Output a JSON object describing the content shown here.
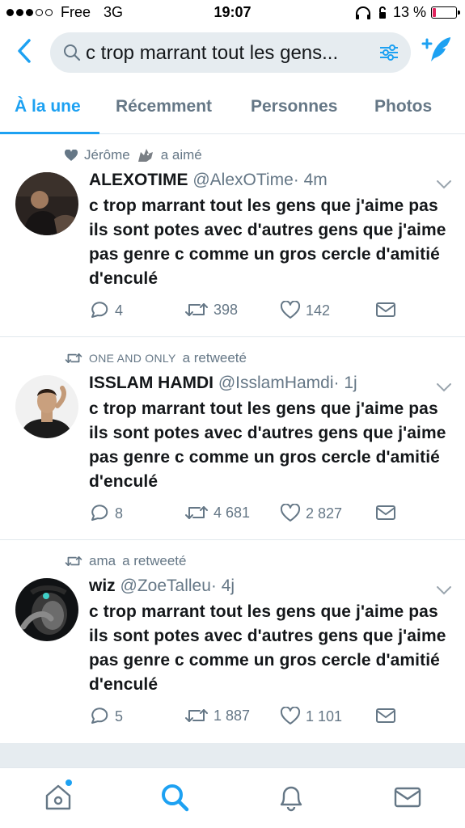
{
  "status_bar": {
    "carrier": "Free",
    "network": "3G",
    "time": "19:07",
    "battery_percent": "13 %",
    "battery_level": 0.13
  },
  "search": {
    "query": "c trop marrant tout les gens..."
  },
  "tabs": [
    {
      "label": "À la une",
      "active": true
    },
    {
      "label": "Récemment",
      "active": false
    },
    {
      "label": "Personnes",
      "active": false
    },
    {
      "label": "Photos",
      "active": false
    }
  ],
  "tweets": [
    {
      "context": {
        "who": "Jérôme",
        "action": "a aimé"
      },
      "name": "ALEXOTIME",
      "handle": "@AlexOTime",
      "time": "· 4m",
      "text": "c trop marrant tout les gens que j'aime pas ils sont potes avec d'autres gens que j'aime pas genre c comme un gros cercle d'amitié d'enculé",
      "replies": "4",
      "retweets": "398",
      "likes": "142"
    },
    {
      "context": {
        "who": "ONE AND ONLY",
        "action": "a retweeté"
      },
      "name": "ISSLAM HAMDI",
      "handle": "@IsslamHamdi",
      "time": "· 1j",
      "text": "c trop marrant tout les gens que j'aime pas ils sont potes avec d'autres gens que j'aime pas genre c comme un gros cercle d'amitié d'enculé",
      "replies": "8",
      "retweets": "4 681",
      "likes": "2 827"
    },
    {
      "context": {
        "who": "ama",
        "action": "a retweeté"
      },
      "name": "wiz",
      "handle": "@ZoeTalleu",
      "time": "· 4j",
      "text": "c trop marrant tout les gens que j'aime pas ils sont potes avec d'autres gens que j'aime pas genre c comme un gros cercle d'amitié d'enculé",
      "replies": "5",
      "retweets": "1 887",
      "likes": "1 101"
    }
  ],
  "colors": {
    "accent": "#1da1f2",
    "muted": "#657786",
    "battery_low": "#e0245e"
  },
  "icons": [
    "back-icon",
    "search-icon",
    "filter-icon",
    "compose-tweet-icon",
    "heart-icon",
    "retweet-icon",
    "reply-icon",
    "message-icon",
    "chevron-down-icon",
    "home-icon",
    "bell-icon"
  ]
}
